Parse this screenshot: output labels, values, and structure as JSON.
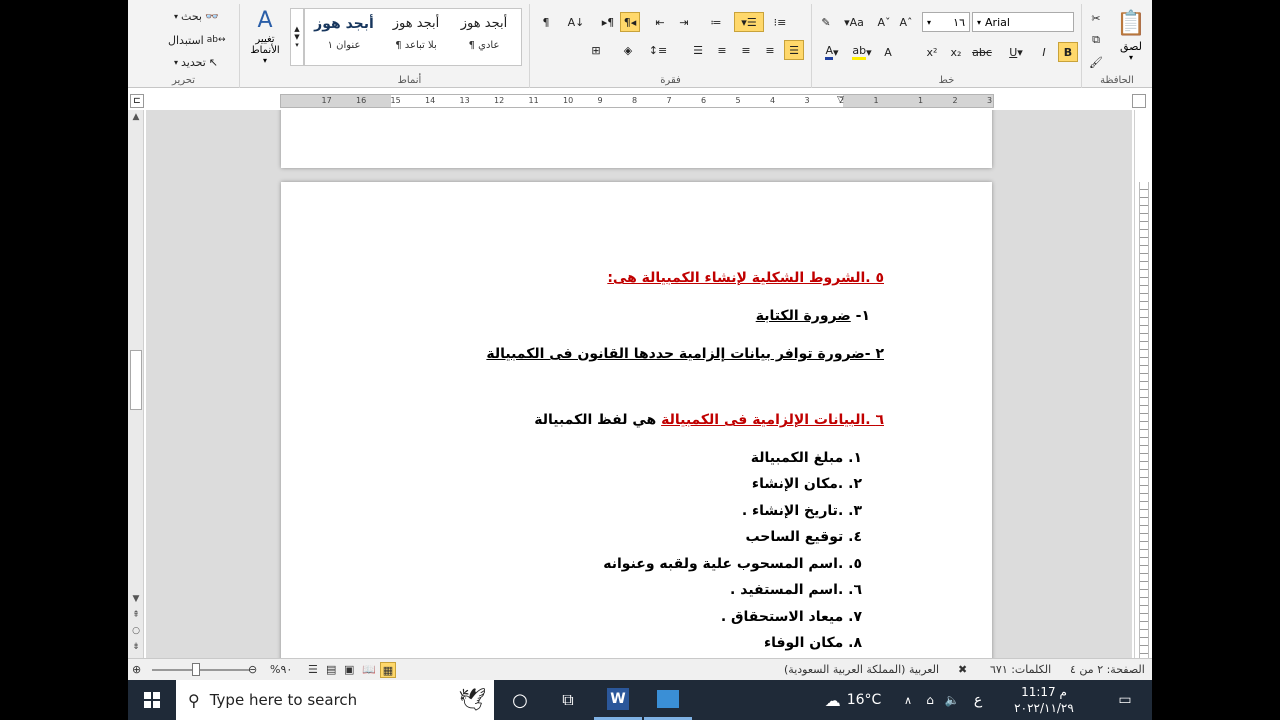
{
  "ribbon": {
    "groups": {
      "clipboard": "الحافظة",
      "font": "خط",
      "paragraph": "فقرة",
      "styles": "أنماط",
      "editing": "تحرير"
    },
    "clipboard": {
      "paste": "لصق"
    },
    "font": {
      "name": "Arial",
      "size": "١٦"
    },
    "styles": [
      {
        "preview": "أبجد هوز",
        "name": "¶ عادي"
      },
      {
        "preview": "أبجد هوز",
        "name": "¶ بلا تباعد"
      },
      {
        "preview": "أبجد هوز",
        "name": "عنوان ١"
      }
    ],
    "change_styles": "تغيير الأنماط",
    "editing": {
      "find": "بحث",
      "replace": "استبدال",
      "select": "تحديد"
    }
  },
  "ruler": {
    "numbers": [
      "3",
      "2",
      "1",
      "1",
      "2",
      "3",
      "4",
      "5",
      "6",
      "7",
      "8",
      "9",
      "10",
      "11",
      "12",
      "13",
      "14",
      "15",
      "16",
      "17"
    ]
  },
  "document": {
    "heading5": "٥ .الشروط الشكلية لإنشاء الكمبيالة هى:",
    "cond1_num": "١- ",
    "cond1_text": "ضرورة الكتابة",
    "cond2": "٢ -ضرورة توافر بيانات إلزامية حددها القانون فى الكمبيالة",
    "heading6": "٦ .البيانات الإلزامية فى الكمبيالة",
    "heading6_suffix": " هي لفظ الكمبيالة",
    "items": [
      "١. مبلغ الكمبيالة",
      "٢. .مكان الإنشاء",
      "٣. .تاريخ الإنشاء .",
      "٤. توقيع الساحب",
      "٥. .اسم المسحوب علية ولقبه وعنوانه",
      "٦. .اسم المستفيد .",
      "٧. ميعاد الاستحقاق .",
      "٨. مكان الوفاء"
    ]
  },
  "status": {
    "page": "الصفحة: ٢ من ٤",
    "words": "الكلمات: ٦٧١",
    "language": "العربية (المملكة العربية السعودية)",
    "zoom": "%٩٠",
    "zoom_level": 0.9
  },
  "taskbar": {
    "search_placeholder": "Type here to search",
    "temperature": "16°C",
    "input_lang": "ع",
    "time": "11:17 م",
    "date": "٢٠٢٢/١١/٢٩"
  },
  "colors": {
    "accent_red": "#c00000",
    "taskbar": "#1f2a38",
    "ribbon": "#f3f3f3"
  }
}
